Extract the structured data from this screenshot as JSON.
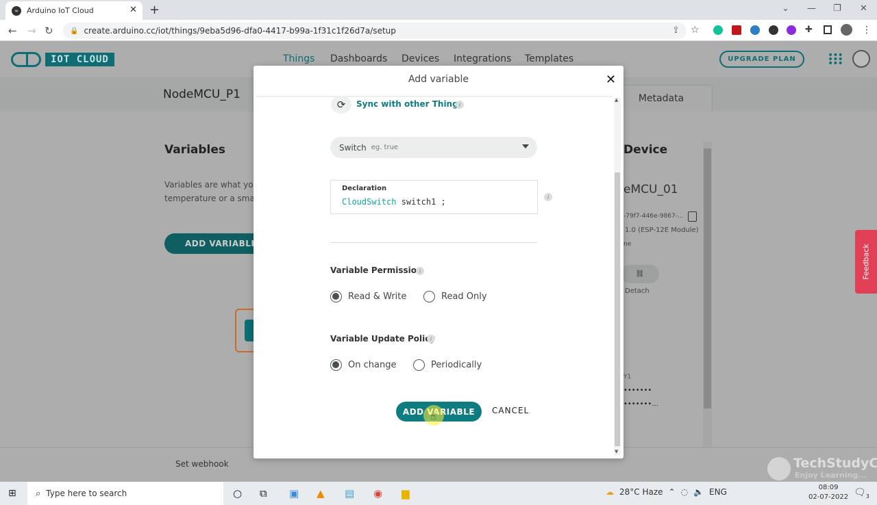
{
  "browser": {
    "tab_title": "Arduino IoT Cloud",
    "url": "create.arduino.cc/iot/things/9eba5d96-dfa0-4417-b99a-1f31c1f26d7a/setup",
    "new_tab": "+",
    "close_tab": "✕"
  },
  "app": {
    "logo_text": "IOT CLOUD",
    "nav": [
      "Things",
      "Dashboards",
      "Devices",
      "Integrations",
      "Templates"
    ],
    "active_nav": "Things",
    "upgrade_label": "UPGRADE PLAN",
    "thing_name": "NodeMCU_P1",
    "tab_metadata": "Metadata"
  },
  "background": {
    "variables_heading": "Variables",
    "variables_desc_1": "Variables are what you",
    "variables_desc_2": "temperature or a smart",
    "add_variable_label": "ADD VARIABLE",
    "device_heading": "Device",
    "device_name": "eMCU_01",
    "device_id": "-79f7-446e-9867-...",
    "device_model": "1.0 (ESP-12E Module)",
    "device_status": "ne",
    "detach_icon": "⛓",
    "detach_label": "Detach",
    "network_ssid": "Y1",
    "masked_1": "•••••••",
    "masked_2": "•••••••...",
    "webhook_label": "Set webhook",
    "feedback_label": "Feedback"
  },
  "modal": {
    "title": "Add variable",
    "close": "✕",
    "sync_label": "Sync with other Things",
    "type_value": "Switch",
    "type_hint": "eg. true",
    "declaration_label": "Declaration",
    "declaration_type": "CloudSwitch",
    "declaration_name": "switch1 ;",
    "permission_label": "Variable Permission",
    "permission_options": [
      "Read & Write",
      "Read Only"
    ],
    "permission_selected": "Read & Write",
    "policy_label": "Variable Update Policy",
    "policy_options": [
      "On change",
      "Periodically"
    ],
    "policy_selected": "On change",
    "add_button": "ADD VARIABLE",
    "cancel_button": "CANCEL",
    "info_glyph": "i"
  },
  "watermark": {
    "title": "TechStudyCell",
    "subtitle": "Enjoy Learning..."
  },
  "taskbar": {
    "search_placeholder": "Type here to search",
    "weather": "28°C Haze",
    "language": "ENG",
    "time": "08:09",
    "date": "02-07-2022",
    "notifications": "3"
  },
  "colors": {
    "accent": "#0e7c80",
    "feedback": "#e13f56"
  }
}
